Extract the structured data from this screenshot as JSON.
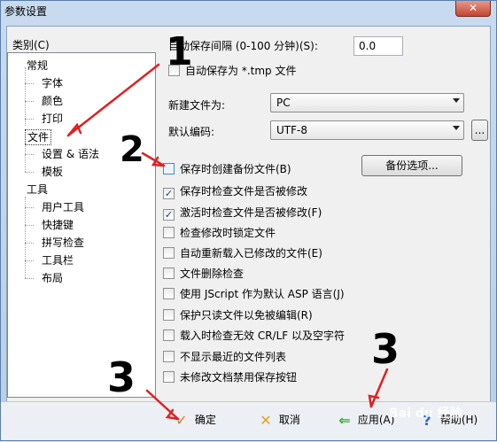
{
  "window": {
    "title": "参数设置",
    "close_symbol": "✕"
  },
  "category": {
    "label": "类别(C)",
    "items": [
      {
        "label": "常规"
      },
      {
        "label": "字体"
      },
      {
        "label": "颜色"
      },
      {
        "label": "打印"
      },
      {
        "label": "文件"
      },
      {
        "label": "设置 & 语法"
      },
      {
        "label": "模板"
      },
      {
        "label": "工具"
      },
      {
        "label": "用户工具"
      },
      {
        "label": "快捷键"
      },
      {
        "label": "拼写检查"
      },
      {
        "label": "工具栏"
      },
      {
        "label": "布局"
      }
    ]
  },
  "autosave": {
    "interval_label": "自动保存间隔 (0-100 分钟)(S):",
    "interval_value": "0.0",
    "as_tmp_label": "自动保存为 *.tmp 文件"
  },
  "new_file": {
    "label": "新建文件为:",
    "value": "PC"
  },
  "encoding": {
    "label": "默认编码:",
    "value": "UTF-8",
    "browse_label": "..."
  },
  "backup_options_label": "备份选项...",
  "options": [
    {
      "label": "保存时创建备份文件(B)",
      "checked": false
    },
    {
      "label": "保存时检查文件是否被修改",
      "checked": true
    },
    {
      "label": "激活时检查文件是否被修改(F)",
      "checked": true
    },
    {
      "label": "检查修改时锁定文件",
      "checked": false
    },
    {
      "label": "自动重新载入已修改的文件(E)",
      "checked": false
    },
    {
      "label": "文件删除检查",
      "checked": false
    },
    {
      "label": "使用 JScript 作为默认 ASP 语言(J)",
      "checked": false
    },
    {
      "label": "保护只读文件以免被编辑(R)",
      "checked": false
    },
    {
      "label": "载入时检查无效 CR/LF 以及空字符",
      "checked": false
    },
    {
      "label": "不显示最近的文件列表",
      "checked": false
    },
    {
      "label": "未修改文档禁用保存按钮",
      "checked": false
    }
  ],
  "actions": {
    "ok_label": "确定",
    "cancel_label": "取消",
    "apply_label": "应用(A)",
    "help_label": "帮助(H)"
  },
  "annotations": {
    "n1": "1",
    "n2": "2",
    "n3a": "3",
    "n3b": "3"
  },
  "watermark": "Bai du 经验"
}
